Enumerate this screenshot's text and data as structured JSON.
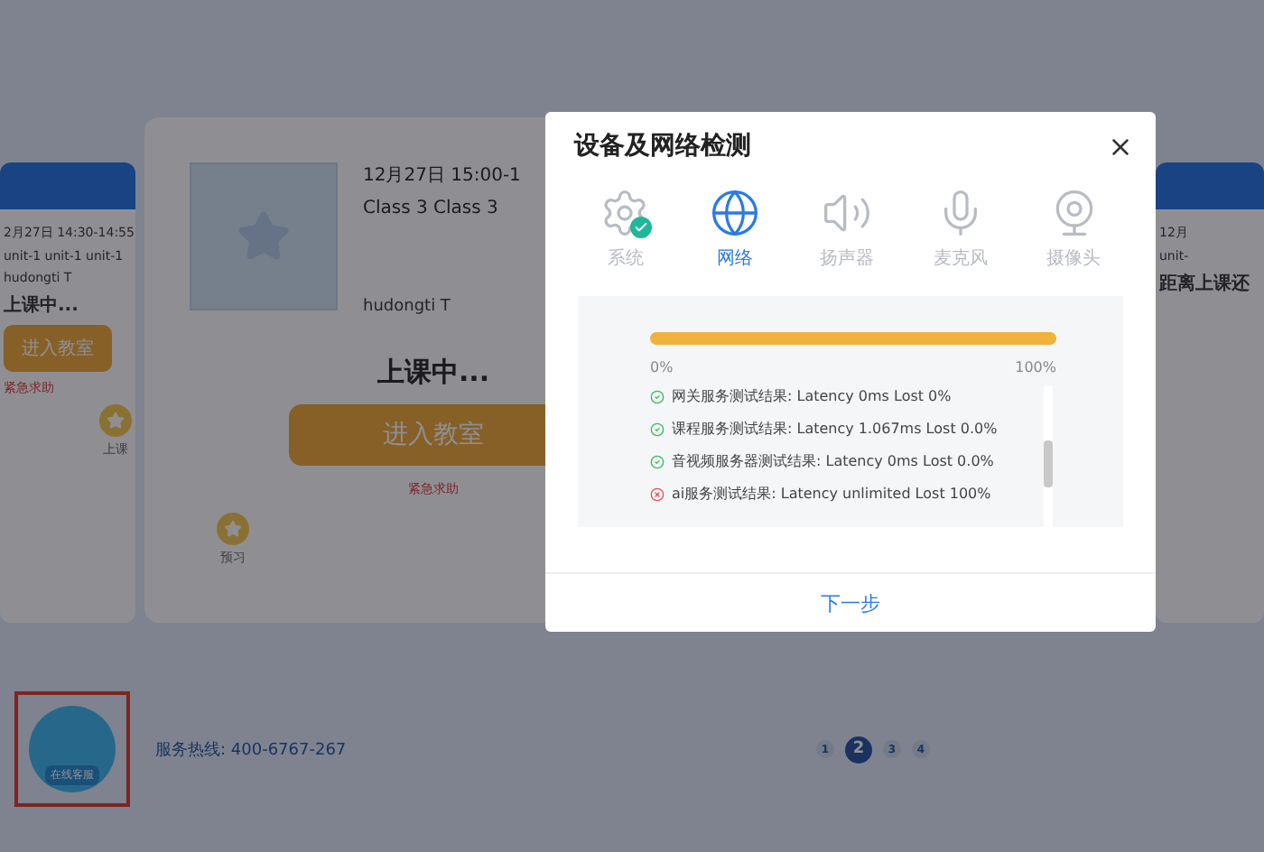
{
  "cards": [
    {
      "kind": "side",
      "date": "2月27日 14:30-14:55",
      "title": "unit-1 unit-1 unit-1",
      "teacher": "hudongti T",
      "status": "上课中...",
      "button": "进入教室",
      "help": "紧急求助",
      "milestone": "上课"
    },
    {
      "kind": "main",
      "date": "12月27日 15:00-1",
      "title": "Class 3 Class 3",
      "teacher": "hudongti T",
      "status": "上课中...",
      "button": "进入教室",
      "help": "紧急求助",
      "milestone": "预习"
    },
    {
      "kind": "side",
      "date": "12月",
      "title": "unit-",
      "status": "距离上课还"
    }
  ],
  "footer": {
    "hotline": "服务热线: 400-6767-267",
    "support_label": "在线客服",
    "pages": [
      {
        "label": "1",
        "selected": false
      },
      {
        "label": "2",
        "selected": true
      },
      {
        "label": "3",
        "selected": false
      },
      {
        "label": "4",
        "selected": false
      }
    ]
  },
  "dialog": {
    "title": "设备及网络检测",
    "steps": [
      {
        "kind": "system",
        "label": "系统",
        "selected": false,
        "done": true
      },
      {
        "kind": "network",
        "label": "网络",
        "selected": true,
        "done": false
      },
      {
        "kind": "speaker",
        "label": "扬声器",
        "selected": false,
        "done": false
      },
      {
        "kind": "microphone",
        "label": "麦克风",
        "selected": false,
        "done": false
      },
      {
        "kind": "camera",
        "label": "摄像头",
        "selected": false,
        "done": false
      }
    ],
    "progress": {
      "level": 1,
      "min_label": "0%",
      "max_label": "100%"
    },
    "results": [
      {
        "text": "网关服务测试结果: Latency 0ms Lost 0%",
        "ok": true
      },
      {
        "text": "课程服务测试结果: Latency 1.067ms Lost 0.0%",
        "ok": true
      },
      {
        "text": "音视频服务器测试结果: Latency 0ms Lost 0.0%",
        "ok": true
      },
      {
        "text": "ai服务测试结果: Latency unlimited Lost 100%",
        "ok": false
      }
    ],
    "next_button": "下一步"
  }
}
